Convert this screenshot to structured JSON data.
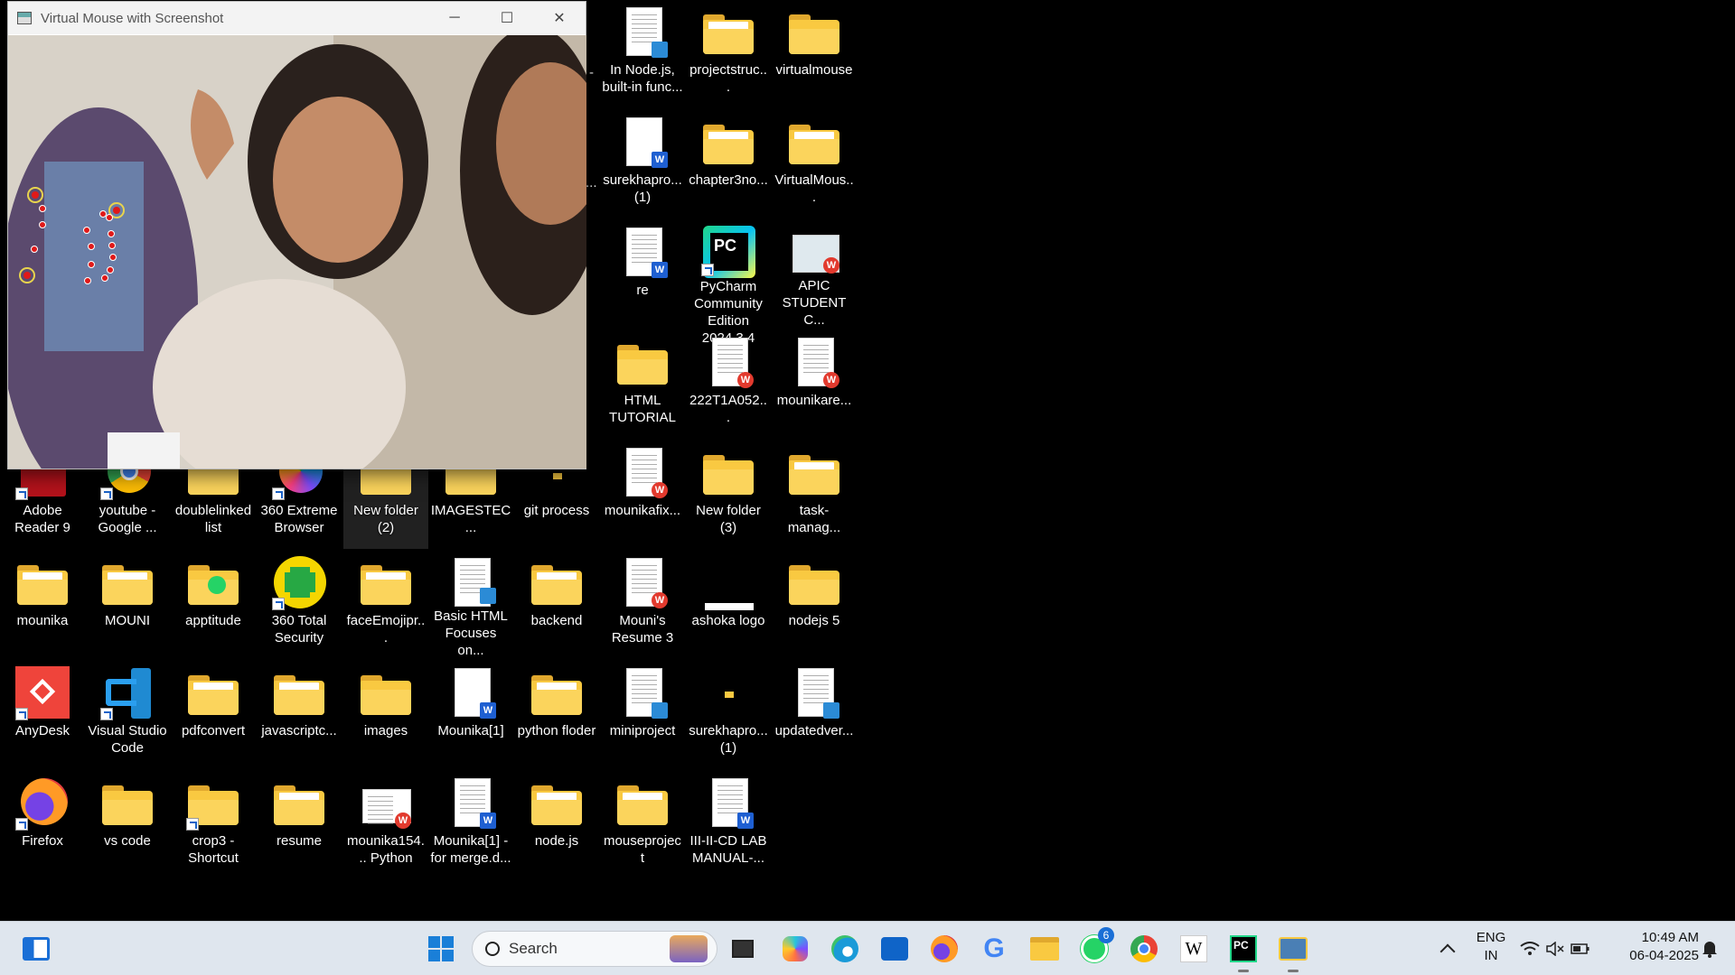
{
  "window": {
    "title": "Virtual Mouse with Screenshot",
    "minimize_glyph": "─",
    "maximize_glyph": "☐",
    "close_glyph": "✕"
  },
  "desktop": {
    "items": [
      {
        "label": "In Node.js, built-in func...",
        "type": "doc"
      },
      {
        "label": "projectstruc...",
        "type": "folder"
      },
      {
        "label": "virtualmouse",
        "type": "folder"
      },
      {
        "label": "surekhapro... (1)",
        "type": "word"
      },
      {
        "label": "chapter3no...",
        "type": "folder"
      },
      {
        "label": "VirtualMous...",
        "type": "folder"
      },
      {
        "label": "re",
        "type": "word"
      },
      {
        "label": "PyCharm Community Edition 2024.3.4",
        "type": "pycharm"
      },
      {
        "label": "APIC STUDENT C...",
        "type": "wps"
      },
      {
        "label": "HTML TUTORIAL",
        "type": "folder"
      },
      {
        "label": "222T1A052...",
        "type": "wps"
      },
      {
        "label": "mounikare...",
        "type": "wps"
      },
      {
        "label": "Adobe Reader 9",
        "type": "app"
      },
      {
        "label": "youtube - Google ...",
        "type": "app"
      },
      {
        "label": "doublelinked list",
        "type": "folder"
      },
      {
        "label": "360 Extreme Browser",
        "type": "app"
      },
      {
        "label": "New folder (2)",
        "type": "folder"
      },
      {
        "label": "IMAGESTEC...",
        "type": "folder"
      },
      {
        "label": "git process",
        "type": "folder"
      },
      {
        "label": "mounikafix...",
        "type": "wps"
      },
      {
        "label": "New folder (3)",
        "type": "folder"
      },
      {
        "label": "task-manag...",
        "type": "folder"
      },
      {
        "label": "mounika",
        "type": "folder"
      },
      {
        "label": "MOUNI",
        "type": "folder"
      },
      {
        "label": "apptitude",
        "type": "folder"
      },
      {
        "label": "360 Total Security",
        "type": "app"
      },
      {
        "label": "faceEmojipr...",
        "type": "folder"
      },
      {
        "label": "Basic HTML Focuses on...",
        "type": "doc"
      },
      {
        "label": "backend",
        "type": "folder"
      },
      {
        "label": "Mouni's Resume 3",
        "type": "wps"
      },
      {
        "label": "ashoka logo",
        "type": "image"
      },
      {
        "label": "nodejs 5",
        "type": "folder"
      },
      {
        "label": "AnyDesk",
        "type": "app"
      },
      {
        "label": "Visual Studio Code",
        "type": "app"
      },
      {
        "label": "pdfconvert",
        "type": "folder"
      },
      {
        "label": "javascriptc...",
        "type": "folder"
      },
      {
        "label": "images",
        "type": "folder"
      },
      {
        "label": "Mounika[1]",
        "type": "word"
      },
      {
        "label": "python floder",
        "type": "folder"
      },
      {
        "label": "miniproject",
        "type": "doc"
      },
      {
        "label": "surekhapro... (1)",
        "type": "folder-small"
      },
      {
        "label": "updatedver...",
        "type": "doc"
      },
      {
        "label": "Firefox",
        "type": "app"
      },
      {
        "label": "vs code",
        "type": "folder"
      },
      {
        "label": "crop3 - Shortcut",
        "type": "folder"
      },
      {
        "label": "resume",
        "type": "folder"
      },
      {
        "label": "mounika154... Python",
        "type": "wps"
      },
      {
        "label": "Mounika[1] - for merge.d...",
        "type": "word"
      },
      {
        "label": "node.js",
        "type": "folder"
      },
      {
        "label": "mouseproject",
        "type": "folder"
      },
      {
        "label": "III-II-CD LAB MANUAL-...",
        "type": "word"
      }
    ],
    "stray_dash": "-",
    "stray_dots": "..."
  },
  "taskbar": {
    "search_placeholder": "Search",
    "lang_line1": "ENG",
    "lang_line2": "IN",
    "time": "10:49 AM",
    "date": "06-04-2025",
    "whatsapp_badge": "6",
    "wiki_glyph": "W",
    "pycharm_glyph": "PC",
    "google_glyph": "G"
  },
  "colors": {
    "folder": "#f9c941",
    "taskbar": "#dfe6ee",
    "landmark": "#e01919",
    "ring": "#e8d44d"
  }
}
